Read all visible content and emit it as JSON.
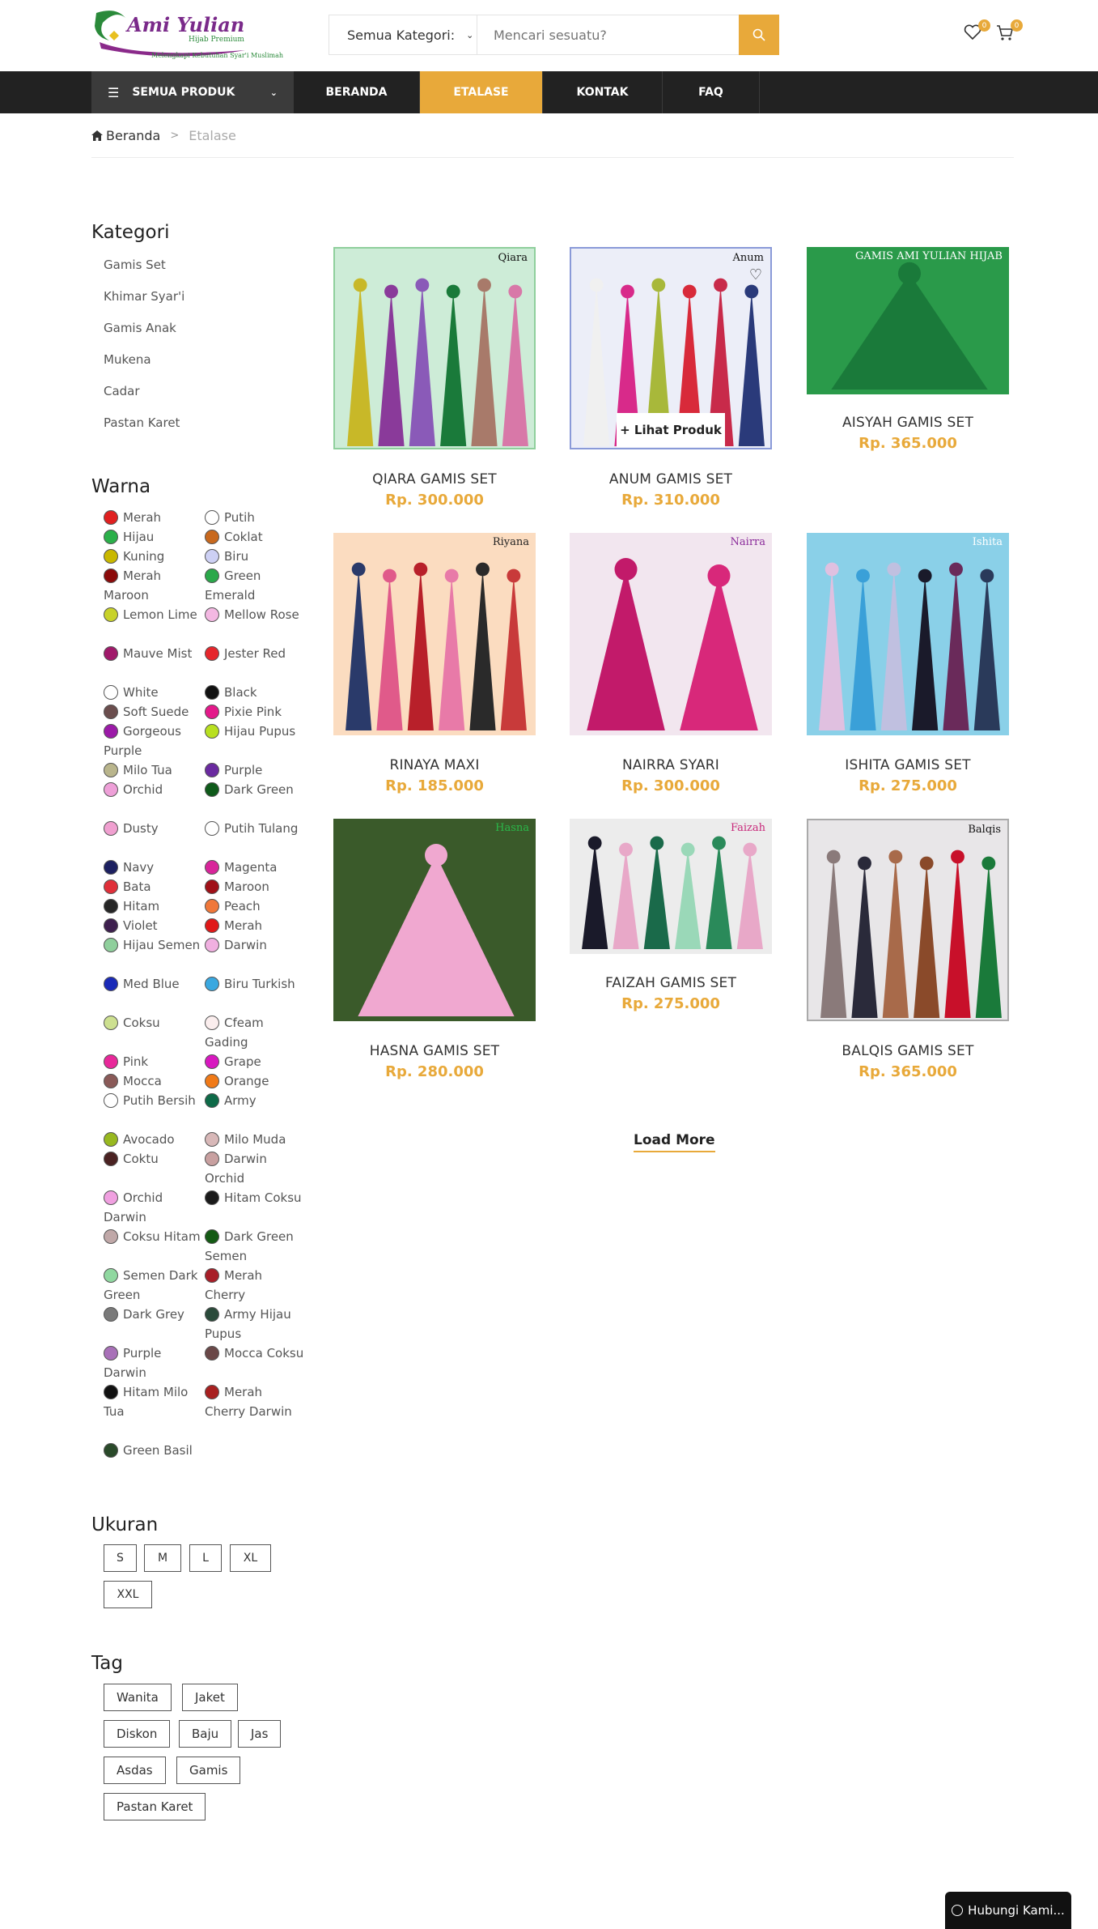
{
  "header": {
    "logo_text": "Ami Yulian",
    "logo_sub": "Hijab Premium",
    "logo_tagline": "Melengkapi Kebutuhan Syar'i Muslimah",
    "category_select": "Semua Kategori:",
    "search_placeholder": "Mencari sesuatu?",
    "wishlist_count": "0",
    "cart_count": "0",
    "accent": "#e8a93a"
  },
  "nav": {
    "all_products": "SEMUA PRODUK",
    "items": [
      "BERANDA",
      "ETALASE",
      "KONTAK",
      "FAQ"
    ],
    "active": "ETALASE"
  },
  "breadcrumb": {
    "home": "Beranda",
    "current": "Etalase"
  },
  "sidebar": {
    "category_title": "Kategori",
    "categories": [
      "Gamis Set",
      "Khimar Syar'i",
      "Gamis Anak",
      "Mukena",
      "Cadar",
      "Pastan Karet"
    ],
    "color_title": "Warna",
    "colors": [
      [
        {
          "name": "Merah",
          "hex": "#e02020"
        },
        {
          "name": "Putih",
          "hex": "#ffffff"
        }
      ],
      [
        {
          "name": "Hijau",
          "hex": "#2bb04a"
        },
        {
          "name": "Coklat",
          "hex": "#c8691e"
        }
      ],
      [
        {
          "name": "Kuning",
          "hex": "#c9b800"
        },
        {
          "name": "Biru",
          "hex": "#cdd0f4"
        }
      ],
      [
        {
          "name": "Merah Maroon",
          "hex": "#8b0a0a"
        },
        {
          "name": "Green Emerald",
          "hex": "#2aa84a"
        }
      ],
      [
        {
          "name": "Lemon Lime",
          "hex": "#c8d22a"
        },
        {
          "name": "Mellow Rose",
          "hex": "#f3b8e2"
        }
      ],
      [
        {
          "name": "Mauve Mist",
          "hex": "#a0196a"
        },
        {
          "name": "Jester Red",
          "hex": "#e6262c"
        }
      ],
      [
        {
          "name": "White",
          "hex": "#ffffff"
        },
        {
          "name": "Black",
          "hex": "#111111"
        }
      ],
      [
        {
          "name": "Soft Suede",
          "hex": "#6b4e4e"
        },
        {
          "name": "Pixie Pink",
          "hex": "#e4198a"
        }
      ],
      [
        {
          "name": "Gorgeous Purple",
          "hex": "#9b1aa8"
        },
        {
          "name": "Hijau Pupus",
          "hex": "#b8e020"
        }
      ],
      [
        {
          "name": "Milo Tua",
          "hex": "#b9b58c"
        },
        {
          "name": "Purple",
          "hex": "#6a2aa0"
        }
      ],
      [
        {
          "name": "Orchid",
          "hex": "#eea0d8"
        },
        {
          "name": "Dark Green",
          "hex": "#0f5a1a"
        }
      ],
      [
        {
          "name": "Dusty",
          "hex": "#f0a0d0"
        },
        {
          "name": "Putih Tulang",
          "hex": "#ffffff"
        }
      ],
      [
        {
          "name": "Navy",
          "hex": "#1c2060"
        },
        {
          "name": "Magenta",
          "hex": "#d8259a"
        }
      ],
      [
        {
          "name": "Bata",
          "hex": "#e0303a"
        },
        {
          "name": "Maroon",
          "hex": "#a01018"
        }
      ],
      [
        {
          "name": "Hitam",
          "hex": "#262626"
        },
        {
          "name": "Peach",
          "hex": "#f0783a"
        }
      ],
      [
        {
          "name": "Violet",
          "hex": "#3d1f4e"
        },
        {
          "name": "Merah",
          "hex": "#e01818"
        }
      ],
      [
        {
          "name": "Hijau Semen",
          "hex": "#8fcf9c"
        },
        {
          "name": "Darwin",
          "hex": "#f0b0e0"
        }
      ],
      [
        {
          "name": "Med Blue",
          "hex": "#1a2ab8"
        },
        {
          "name": "Biru Turkish",
          "hex": "#3aa8e0"
        }
      ],
      [
        {
          "name": "Coksu",
          "hex": "#cde090"
        },
        {
          "name": "Cfeam Gading",
          "hex": "#fbeeee"
        }
      ],
      [
        {
          "name": "Pink",
          "hex": "#e8289a"
        },
        {
          "name": "Grape",
          "hex": "#d818c0"
        }
      ],
      [
        {
          "name": "Mocca",
          "hex": "#8a5a58"
        },
        {
          "name": "Orange",
          "hex": "#f07a18"
        }
      ],
      [
        {
          "name": "Putih Bersih",
          "hex": "#ffffff"
        },
        {
          "name": "Army",
          "hex": "#0e6a48"
        }
      ],
      [
        {
          "name": "Avocado",
          "hex": "#98b820"
        },
        {
          "name": "Milo Muda",
          "hex": "#d8b8b8"
        }
      ],
      [
        {
          "name": "Coktu",
          "hex": "#4a2222"
        },
        {
          "name": "Darwin Orchid",
          "hex": "#c8a0a0"
        }
      ],
      [
        {
          "name": "Orchid Darwin",
          "hex": "#f0a0e0"
        },
        {
          "name": "Hitam Coksu",
          "hex": "#1a1a1a"
        }
      ],
      [
        {
          "name": "Coksu Hitam",
          "hex": "#c0a8a8"
        },
        {
          "name": "Dark Green Semen",
          "hex": "#145a14"
        }
      ],
      [
        {
          "name": "Semen Dark Green",
          "hex": "#90d8a0"
        },
        {
          "name": "Merah Cherry",
          "hex": "#a81e28"
        }
      ],
      [
        {
          "name": "Dark Grey",
          "hex": "#7a7a7a"
        },
        {
          "name": "Army Hijau Pupus",
          "hex": "#2a4a3a"
        }
      ],
      [
        {
          "name": "Purple Darwin",
          "hex": "#a870b8"
        },
        {
          "name": "Mocca Coksu",
          "hex": "#6a4848"
        }
      ],
      [
        {
          "name": "Hitam Milo Tua",
          "hex": "#111111"
        },
        {
          "name": "Merah Cherry Darwin",
          "hex": "#a82020"
        }
      ],
      [
        {
          "name": "Green Basil",
          "hex": "#2a4a2a"
        }
      ]
    ],
    "size_title": "Ukuran",
    "sizes": [
      "S",
      "M",
      "L",
      "XL",
      "XXL"
    ],
    "tag_title": "Tag",
    "tags": [
      "Wanita",
      "Jaket",
      "Diskon",
      "Baju",
      "Jas",
      "Asdas",
      "Gamis",
      "Pastan Karet"
    ]
  },
  "products": [
    {
      "name": "QIARA GAMIS SET",
      "price": "Rp. 300.000",
      "img_label": "Qiara"
    },
    {
      "name": "ANUM GAMIS SET",
      "price": "Rp. 310.000",
      "img_label": "Anum"
    },
    {
      "name": "AISYAH GAMIS SET",
      "price": "Rp. 365.000",
      "img_label": "GAMIS AMI YULIAN HIJAB"
    },
    {
      "name": "RINAYA MAXI",
      "price": "Rp. 185.000",
      "img_label": "Riyana"
    },
    {
      "name": "NAIRRA SYARI",
      "price": "Rp. 300.000",
      "img_label": "Nairra"
    },
    {
      "name": "ISHITA GAMIS SET",
      "price": "Rp. 275.000",
      "img_label": "Ishita"
    },
    {
      "name": "HASNA GAMIS SET",
      "price": "Rp. 280.000",
      "img_label": "Hasna"
    },
    {
      "name": "FAIZAH GAMIS SET",
      "price": "Rp. 275.000",
      "img_label": "Faizah"
    },
    {
      "name": "BALQIS GAMIS SET",
      "price": "Rp. 365.000",
      "img_label": "Balqis"
    }
  ],
  "quick_view": "+ Lihat Produk",
  "load_more": "Load More",
  "contact_button": "Hubungi Kami..."
}
